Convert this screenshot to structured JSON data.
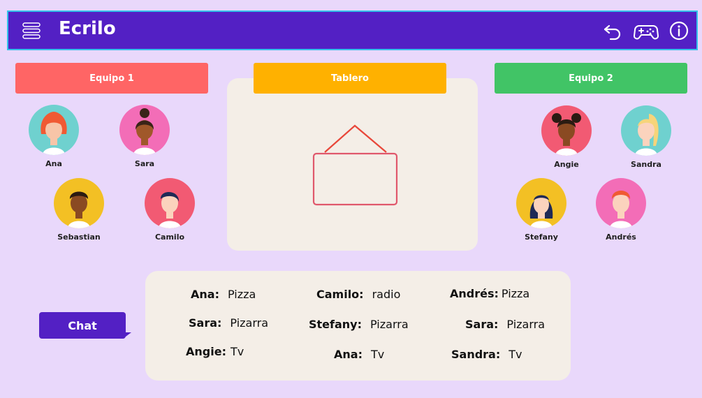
{
  "app": {
    "title": "Ecrilo"
  },
  "header": {
    "icons": [
      "menu-icon",
      "undo-icon",
      "gamepad-icon",
      "info-icon"
    ]
  },
  "teams": {
    "team1": {
      "label": "Equipo 1",
      "color": "#ff6565"
    },
    "board": {
      "label": "Tablero",
      "color": "#ffb100"
    },
    "team2": {
      "label": "Equipo 2",
      "color": "#41c466"
    }
  },
  "players": {
    "team1": [
      {
        "name": "Ana",
        "bg": "#6fd1cf"
      },
      {
        "name": "Sara",
        "bg": "#f36db7"
      },
      {
        "name": "Sebastian",
        "bg": "#f3c024"
      },
      {
        "name": "Camilo",
        "bg": "#f25a73"
      }
    ],
    "team2": [
      {
        "name": "Angie",
        "bg": "#f25a73"
      },
      {
        "name": "Sandra",
        "bg": "#6fd1cf"
      },
      {
        "name": "Stefany",
        "bg": "#f3c024"
      },
      {
        "name": "Andrés",
        "bg": "#f36db7"
      }
    ]
  },
  "chat": {
    "label": "Chat"
  },
  "answers": [
    {
      "name": "Ana:",
      "value": "Pizza"
    },
    {
      "name": "Camilo:",
      "value": "radio"
    },
    {
      "name": "Andrés:",
      "value": "Pizza"
    },
    {
      "name": "Sara:",
      "value": "Pizarra"
    },
    {
      "name": "Stefany:",
      "value": "Pizarra"
    },
    {
      "name": "Sara:",
      "value": "Pizarra"
    },
    {
      "name": "Angie:",
      "value": "Tv"
    },
    {
      "name": "Ana:",
      "value": "Tv"
    },
    {
      "name": "Sandra:",
      "value": "Tv"
    }
  ]
}
